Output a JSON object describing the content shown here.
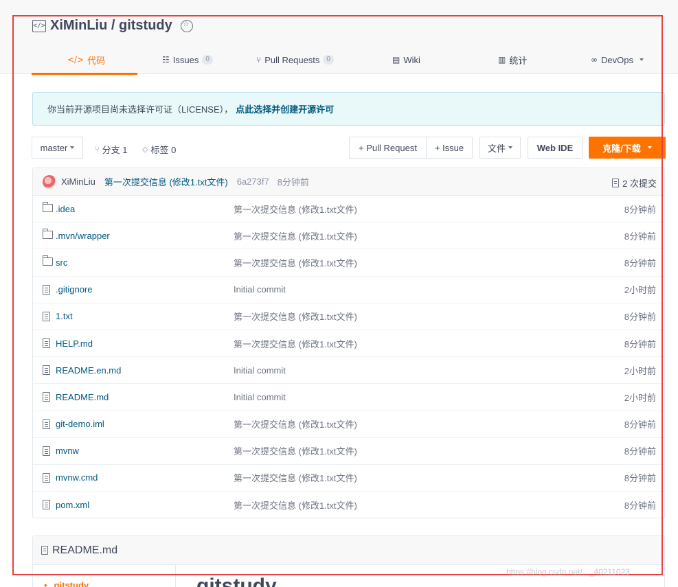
{
  "repo": {
    "owner_repo": "XiMinLiu / gitstudy"
  },
  "tabs": [
    {
      "label": "代码",
      "icon": "code-icon"
    },
    {
      "label": "Issues",
      "count": "0",
      "icon": "issues-icon"
    },
    {
      "label": "Pull Requests",
      "count": "0",
      "icon": "pull-request-icon"
    },
    {
      "label": "Wiki",
      "icon": "wiki-icon"
    },
    {
      "label": "统计",
      "icon": "stats-icon"
    },
    {
      "label": "DevOps",
      "icon": "devops-icon"
    }
  ],
  "license_notice": {
    "text": "你当前开源项目尚未选择许可证（LICENSE），",
    "link": "点此选择并创建开源许可"
  },
  "toolbar": {
    "branch": "master",
    "branches": "分支 1",
    "tags": "标签 0",
    "new_pr": "+ Pull Request",
    "new_issue": "+ Issue",
    "file_menu": "文件",
    "web_ide": "Web IDE",
    "clone": "克隆/下载"
  },
  "last_commit": {
    "author": "XiMinLiu",
    "message": "第一次提交信息 (修改1.txt文件)",
    "sha": "6a273f7",
    "time": "8分钟前",
    "commit_count": "2 次提交"
  },
  "files": [
    {
      "name": ".idea",
      "type": "folder",
      "message": "第一次提交信息 (修改1.txt文件)",
      "time": "8分钟前"
    },
    {
      "name": ".mvn/wrapper",
      "type": "folder",
      "message": "第一次提交信息 (修改1.txt文件)",
      "time": "8分钟前"
    },
    {
      "name": "src",
      "type": "folder",
      "message": "第一次提交信息 (修改1.txt文件)",
      "time": "8分钟前"
    },
    {
      "name": ".gitignore",
      "type": "file",
      "message": "Initial commit",
      "time": "2小时前"
    },
    {
      "name": "1.txt",
      "type": "file",
      "message": "第一次提交信息 (修改1.txt文件)",
      "time": "8分钟前"
    },
    {
      "name": "HELP.md",
      "type": "file",
      "message": "第一次提交信息 (修改1.txt文件)",
      "time": "8分钟前"
    },
    {
      "name": "README.en.md",
      "type": "file",
      "message": "Initial commit",
      "time": "2小时前"
    },
    {
      "name": "README.md",
      "type": "file",
      "message": "Initial commit",
      "time": "2小时前"
    },
    {
      "name": "git-demo.iml",
      "type": "file",
      "message": "第一次提交信息 (修改1.txt文件)",
      "time": "8分钟前"
    },
    {
      "name": "mvnw",
      "type": "file",
      "message": "第一次提交信息 (修改1.txt文件)",
      "time": "8分钟前"
    },
    {
      "name": "mvnw.cmd",
      "type": "file",
      "message": "第一次提交信息 (修改1.txt文件)",
      "time": "8分钟前"
    },
    {
      "name": "pom.xml",
      "type": "file",
      "message": "第一次提交信息 (修改1.txt文件)",
      "time": "8分钟前"
    }
  ],
  "readme": {
    "filename": "README.md",
    "toc_item": "gitstudy",
    "heading": "gitstudy"
  },
  "watermark": "https://blog.csdn.net/..._40211023",
  "colors": {
    "accent": "#fe7300",
    "link": "#005980",
    "highlight_frame": "#e84040"
  }
}
